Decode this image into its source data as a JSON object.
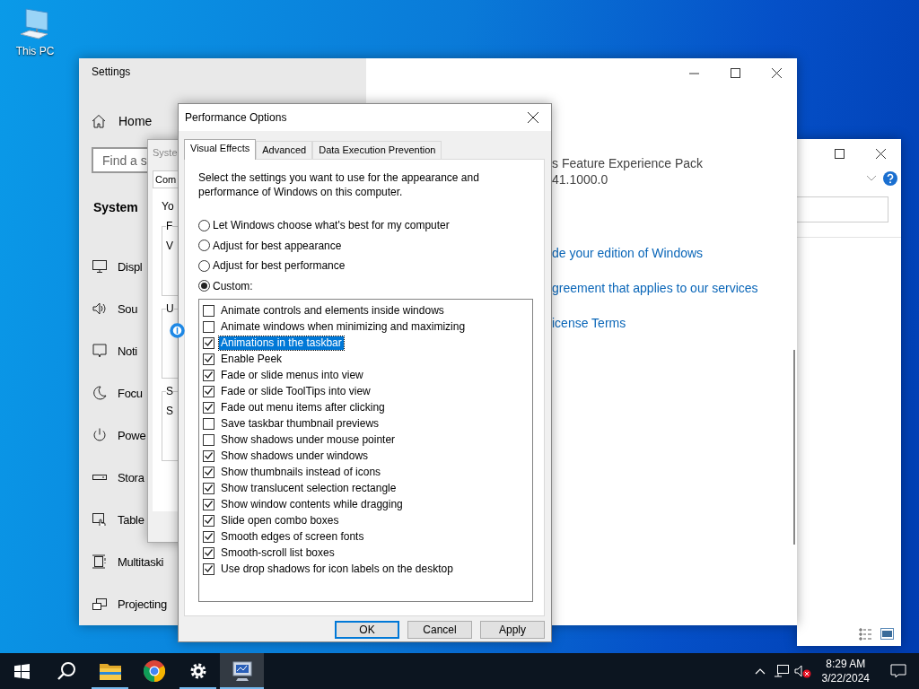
{
  "desktop_icons": [
    {
      "label": "This PC"
    }
  ],
  "settings_window": {
    "title": "Settings",
    "home": "Home",
    "search": {
      "placeholder": "Find a s"
    },
    "section": "System",
    "nav_items": [
      {
        "label": "Displ"
      },
      {
        "label": "Sou"
      },
      {
        "label": "Noti"
      },
      {
        "label": "Focu"
      },
      {
        "label": "Powe"
      },
      {
        "label": "Stora"
      },
      {
        "label": "Table"
      },
      {
        "label": "Multitaski"
      },
      {
        "label": "Projecting"
      }
    ],
    "content": [
      {
        "kind": "text",
        "text": "s Feature Experience Pack"
      },
      {
        "kind": "text",
        "text": "41.1000.0"
      },
      {
        "kind": "link",
        "text": "de your edition of Windows"
      },
      {
        "kind": "link",
        "text": "greement that applies to our services"
      },
      {
        "kind": "link",
        "text": "icense Terms"
      }
    ]
  },
  "system_properties_window": {
    "title": "Syste",
    "tab": "Com",
    "intro": "Yo",
    "groups": [
      {
        "label": "F",
        "text": "V"
      },
      {
        "label": "U"
      },
      {
        "label": "S",
        "text": "S"
      }
    ]
  },
  "performance_dialog": {
    "title": "Performance Options",
    "tabs": [
      {
        "label": "Visual Effects",
        "selected": true
      },
      {
        "label": "Advanced",
        "selected": false
      },
      {
        "label": "Data Execution Prevention",
        "selected": false
      }
    ],
    "description": "Select the settings you want to use for the appearance and performance of Windows on this computer.",
    "options": [
      {
        "label": "Let Windows choose what's best for my computer",
        "selected": false
      },
      {
        "label": "Adjust for best appearance",
        "selected": false
      },
      {
        "label": "Adjust for best performance",
        "selected": false
      },
      {
        "label": "Custom:",
        "selected": true
      }
    ],
    "effects": [
      {
        "label": "Animate controls and elements inside windows",
        "checked": false,
        "selected": false
      },
      {
        "label": "Animate windows when minimizing and maximizing",
        "checked": false,
        "selected": false
      },
      {
        "label": "Animations in the taskbar",
        "checked": true,
        "selected": true
      },
      {
        "label": "Enable Peek",
        "checked": true,
        "selected": false
      },
      {
        "label": "Fade or slide menus into view",
        "checked": true,
        "selected": false
      },
      {
        "label": "Fade or slide ToolTips into view",
        "checked": true,
        "selected": false
      },
      {
        "label": "Fade out menu items after clicking",
        "checked": true,
        "selected": false
      },
      {
        "label": "Save taskbar thumbnail previews",
        "checked": false,
        "selected": false
      },
      {
        "label": "Show shadows under mouse pointer",
        "checked": false,
        "selected": false
      },
      {
        "label": "Show shadows under windows",
        "checked": true,
        "selected": false
      },
      {
        "label": "Show thumbnails instead of icons",
        "checked": true,
        "selected": false
      },
      {
        "label": "Show translucent selection rectangle",
        "checked": true,
        "selected": false
      },
      {
        "label": "Show window contents while dragging",
        "checked": true,
        "selected": false
      },
      {
        "label": "Slide open combo boxes",
        "checked": true,
        "selected": false
      },
      {
        "label": "Smooth edges of screen fonts",
        "checked": true,
        "selected": false
      },
      {
        "label": "Smooth-scroll list boxes",
        "checked": true,
        "selected": false
      },
      {
        "label": "Use drop shadows for icon labels on the desktop",
        "checked": true,
        "selected": false
      }
    ],
    "buttons": [
      {
        "label": "OK",
        "default": true
      },
      {
        "label": "Cancel",
        "default": false
      },
      {
        "label": "Apply",
        "default": false
      }
    ]
  },
  "taskbar": {
    "buttons": [
      {
        "kind": "start"
      },
      {
        "kind": "search"
      },
      {
        "kind": "folder",
        "running": true,
        "active": false
      },
      {
        "kind": "chrome",
        "running": false,
        "active": false
      },
      {
        "kind": "gear",
        "running": true,
        "active": false
      },
      {
        "kind": "performance",
        "running": true,
        "active": true
      }
    ],
    "clock": {
      "time": "8:29 AM",
      "date": "3/22/2024"
    }
  }
}
